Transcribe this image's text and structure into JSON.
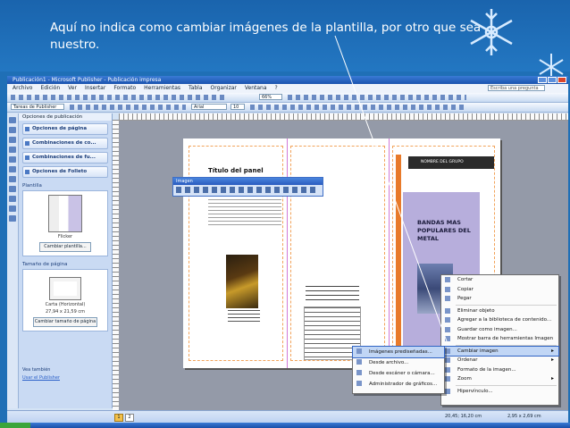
{
  "slide": {
    "caption": "Aquí no indica como cambiar imágenes de la plantilla, por otro que sea nuestro."
  },
  "window": {
    "title": "Publicación1 - Microsoft Publisher - Publicación impresa"
  },
  "menu": [
    "Archivo",
    "Edición",
    "Ver",
    "Insertar",
    "Formato",
    "Herramientas",
    "Tabla",
    "Organizar",
    "Ventana",
    "?"
  ],
  "help_box": "Escriba una pregunta",
  "toolbar": {
    "font_box": "Arial",
    "size_box": "10",
    "zoom_box": "66%",
    "tasks_box": "Tareas de Publisher"
  },
  "taskpane": {
    "title": "Opciones de publicación",
    "items": [
      "Opciones de página",
      "Combinaciones de co...",
      "Combinaciones de fu...",
      "Opciones de Folleto"
    ],
    "template_label": "Plantilla",
    "template_name": "Flicker",
    "change_template_button": "Cambiar plantilla...",
    "page_size_label": "Tamaño de página",
    "page_size_value": "Carta (Horizontal)",
    "page_size_dims": "27,94 x 21,59 cm",
    "change_size_button": "Cambiar tamaño de página",
    "see_also": "Vea también",
    "link": "Usar el Publisher"
  },
  "document": {
    "left_title": "Título del panel",
    "right_header": "NOMBRE DEL GRUPO",
    "right_title": "BANDAS MAS POPULARES DEL METAL"
  },
  "image_toolbar": {
    "title": "Imagen"
  },
  "context_menu": [
    {
      "label": "Cortar",
      "hl": false
    },
    {
      "label": "Copiar",
      "hl": false
    },
    {
      "label": "Pegar",
      "hl": false
    },
    {
      "label": "Eliminar objeto",
      "hl": false
    },
    {
      "label": "Agregar a la biblioteca de contenido...",
      "hl": false
    },
    {
      "label": "Guardar como imagen...",
      "hl": false
    },
    {
      "label": "Mostrar barra de herramientas Imagen",
      "hl": false
    },
    {
      "label": "Cambiar imagen",
      "hl": true,
      "submenu": true
    },
    {
      "label": "Ordenar",
      "hl": false,
      "submenu": true
    },
    {
      "label": "Formato de la imagen...",
      "hl": false
    },
    {
      "label": "Zoom",
      "hl": false,
      "submenu": true
    },
    {
      "label": "Hipervínculo...",
      "hl": false
    }
  ],
  "submenu": [
    "Imágenes prediseñadas...",
    "Desde archivo...",
    "Desde escáner o cámara...",
    "Administrador de gráficos..."
  ],
  "status": {
    "page1": "1",
    "page2": "2",
    "pos": "20,45; 16,20 cm",
    "size": "2,95 x 2,69 cm"
  }
}
